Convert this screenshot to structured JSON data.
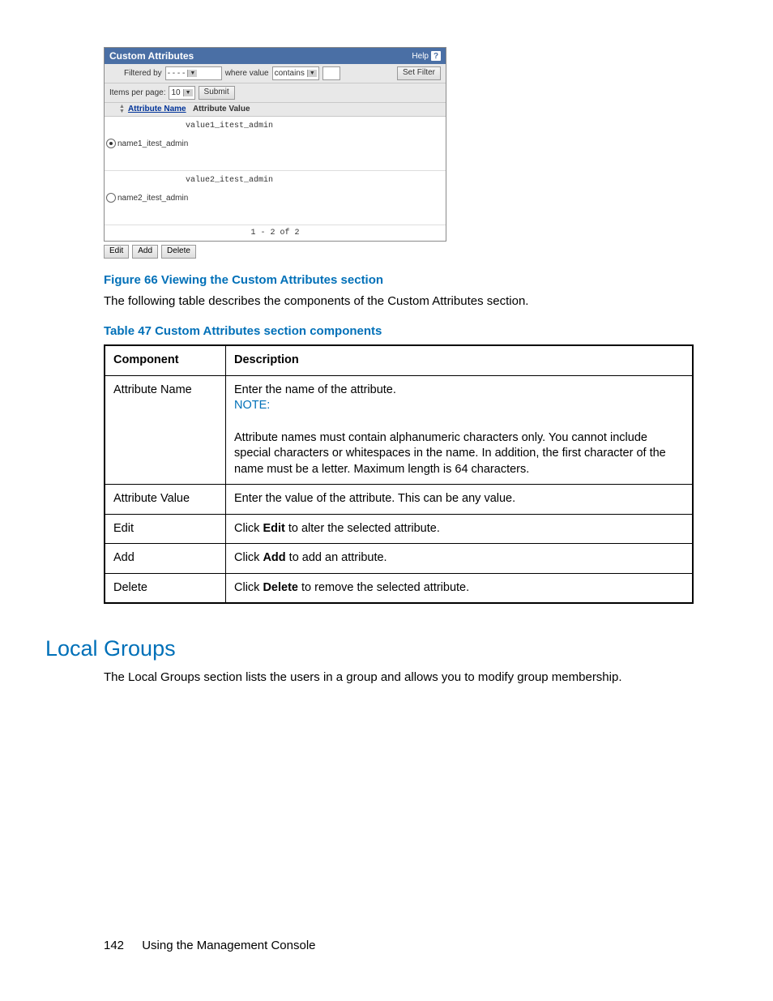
{
  "widget": {
    "title": "Custom Attributes",
    "help_text": "Help",
    "filtered_by_label": "Filtered by",
    "filter_field": "- - - -",
    "where_value_label": "where value",
    "filter_op": "contains",
    "set_filter": "Set Filter",
    "items_per_page_label": "Items per page:",
    "items_per_page_value": "10",
    "submit": "Submit",
    "col_name": "Attribute Name",
    "col_value": "Attribute Value",
    "rows": [
      {
        "name": "name1_itest_admin",
        "value": "value1_itest_admin",
        "selected": true
      },
      {
        "name": "name2_itest_admin",
        "value": "value2_itest_admin",
        "selected": false
      }
    ],
    "paging": "1 - 2 of 2",
    "btn_edit": "Edit",
    "btn_add": "Add",
    "btn_delete": "Delete"
  },
  "figure_caption": "Figure 66 Viewing the Custom Attributes section",
  "intro_text": "The following table describes the components of the Custom Attributes section.",
  "table_caption": "Table 47 Custom Attributes section components",
  "table": {
    "head": {
      "c1": "Component",
      "c2": "Description"
    },
    "rows": {
      "r0": {
        "c1": "Attribute Name",
        "p1": "Enter the name of the attribute.",
        "note": "NOTE:",
        "p2": "Attribute names must contain alphanumeric characters only. You cannot include special characters or whitespaces in the name. In addition, the first character of the name must be a letter. Maximum length is 64 characters."
      },
      "r1": {
        "c1": "Attribute Value",
        "c2": "Enter the value of the attribute. This can be any value."
      },
      "r2": {
        "c1": "Edit",
        "pre": "Click ",
        "b": "Edit",
        "post": " to alter the selected attribute."
      },
      "r3": {
        "c1": "Add",
        "pre": "Click ",
        "b": "Add",
        "post": " to add an attribute."
      },
      "r4": {
        "c1": "Delete",
        "pre": "Click ",
        "b": "Delete",
        "post": " to remove the selected attribute."
      }
    }
  },
  "section_heading": "Local Groups",
  "section_text": "The Local Groups section lists the users in a group and allows you to modify group membership.",
  "footer": {
    "page": "142",
    "title": "Using the Management Console"
  }
}
